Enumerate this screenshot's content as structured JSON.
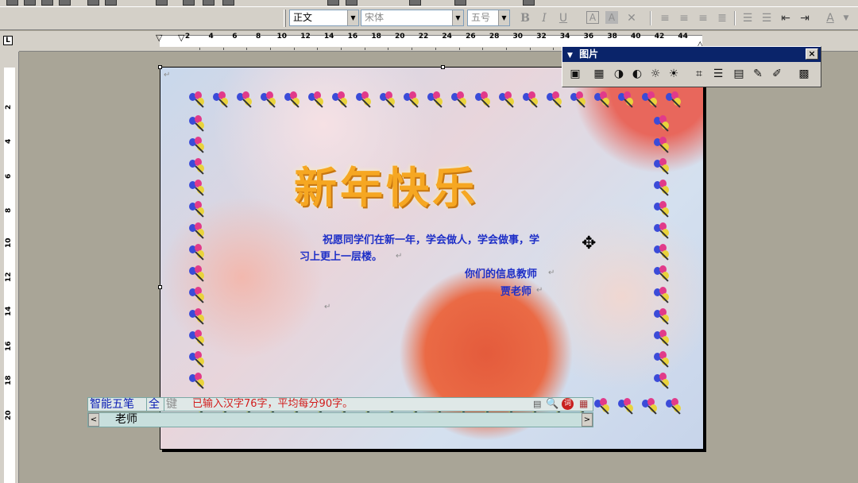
{
  "format_toolbar": {
    "style": "正文",
    "font": "宋体",
    "size": "五号",
    "bold": "B",
    "italic": "I",
    "underline": "U",
    "char_border": "A",
    "char_shading": "A",
    "font_color": "A"
  },
  "ruler": {
    "h_numbers": [
      "2",
      "4",
      "6",
      "8",
      "10",
      "12",
      "14",
      "16",
      "18",
      "20",
      "22",
      "24",
      "26",
      "28",
      "30",
      "32",
      "34",
      "36",
      "38",
      "40",
      "42",
      "44"
    ],
    "v_numbers": [
      "2",
      "4",
      "6",
      "8",
      "10",
      "12",
      "14",
      "16",
      "18",
      "20"
    ],
    "corner": "L"
  },
  "document": {
    "title": "新年快乐",
    "line1": "祝愿同学们在新一年，学会做人，学会做事，学",
    "line2": "习上更上一层楼。",
    "sign1": "你们的信息教师",
    "sign2": "贾老师",
    "para_mark": "↵"
  },
  "picture_toolbar": {
    "caption": "图片",
    "close": "×"
  },
  "ime": {
    "mode": "智能五笔",
    "full": "全",
    "key": "键",
    "status": "已输入汉字76字，平均每分90字。",
    "candidate": "老师",
    "left_arrow": "<",
    "right_arrow": ">"
  }
}
